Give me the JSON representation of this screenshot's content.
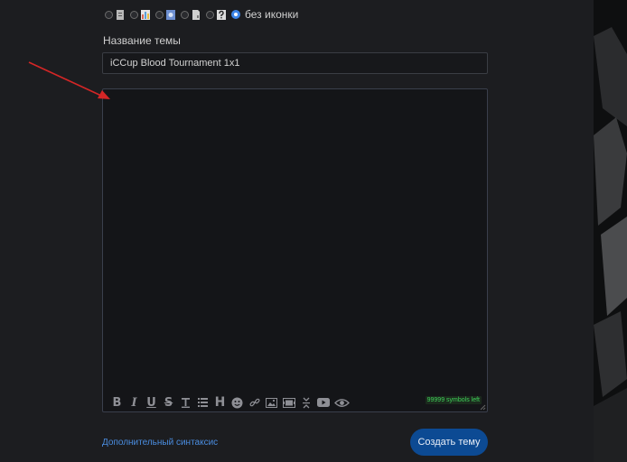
{
  "icons": {
    "options": [
      {
        "name": "doc",
        "color": "#b8b8b8"
      },
      {
        "name": "chart",
        "color": "#d96b5a"
      },
      {
        "name": "film",
        "color": "#6d8fd1"
      },
      {
        "name": "page",
        "color": "#cfcfcf"
      },
      {
        "name": "question",
        "color": "#dcdcdc"
      }
    ],
    "no_icon_label": "без иконки"
  },
  "title_field": {
    "label": "Название темы",
    "value": "iCCup Blood Tournament 1x1"
  },
  "editor": {
    "value": "",
    "toolbar": [
      "bold",
      "italic",
      "underline",
      "strike",
      "heading-t",
      "list",
      "heading",
      "emoji",
      "link",
      "image",
      "gallery",
      "collapse",
      "youtube",
      "preview"
    ],
    "bold_label": "B",
    "italic_label": "I",
    "underline_label": "U",
    "strike_label": "S",
    "heading_label": "H",
    "char_count": "99999 symbols left"
  },
  "footer": {
    "syntax_link": "Дополнительный синтаксис",
    "create_button": "Создать тему"
  },
  "colors": {
    "accent": "#0c4a93",
    "link": "#4a8de0",
    "counter": "#3fd25a",
    "arrow": "#d42626"
  }
}
